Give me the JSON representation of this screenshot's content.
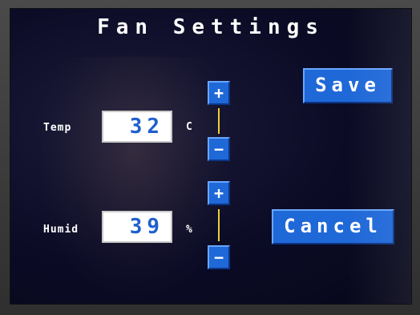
{
  "screen": {
    "title": "Fan Settings"
  },
  "temp": {
    "label": "Temp",
    "value": "32",
    "unit": "C",
    "increment_label": "+",
    "decrement_label": "−"
  },
  "humid": {
    "label": "Humid",
    "value": "39",
    "unit": "%",
    "increment_label": "+",
    "decrement_label": "−"
  },
  "actions": {
    "save_label": "Save",
    "cancel_label": "Cancel"
  },
  "colors": {
    "button_blue": "#1f68d8",
    "value_text_blue": "#1f5fcf",
    "connector_yellow": "#f0d030",
    "screen_background": "#0b0b26"
  }
}
